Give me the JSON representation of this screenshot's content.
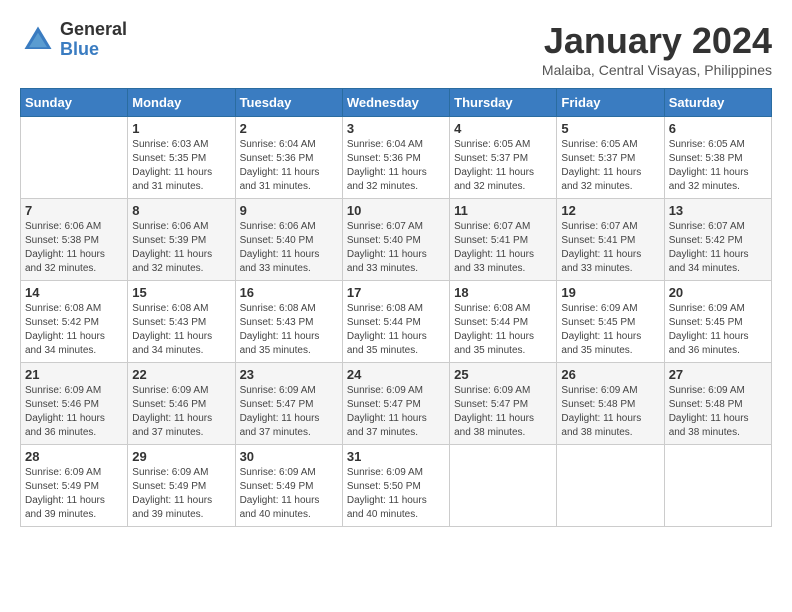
{
  "header": {
    "logo_general": "General",
    "logo_blue": "Blue",
    "title": "January 2024",
    "location": "Malaiba, Central Visayas, Philippines"
  },
  "days_of_week": [
    "Sunday",
    "Monday",
    "Tuesday",
    "Wednesday",
    "Thursday",
    "Friday",
    "Saturday"
  ],
  "weeks": [
    [
      {
        "day": "",
        "sunrise": "",
        "sunset": "",
        "daylight": ""
      },
      {
        "day": "1",
        "sunrise": "6:03 AM",
        "sunset": "5:35 PM",
        "hours": "11",
        "minutes": "31"
      },
      {
        "day": "2",
        "sunrise": "6:04 AM",
        "sunset": "5:36 PM",
        "hours": "11",
        "minutes": "31"
      },
      {
        "day": "3",
        "sunrise": "6:04 AM",
        "sunset": "5:36 PM",
        "hours": "11",
        "minutes": "32"
      },
      {
        "day": "4",
        "sunrise": "6:05 AM",
        "sunset": "5:37 PM",
        "hours": "11",
        "minutes": "32"
      },
      {
        "day": "5",
        "sunrise": "6:05 AM",
        "sunset": "5:37 PM",
        "hours": "11",
        "minutes": "32"
      },
      {
        "day": "6",
        "sunrise": "6:05 AM",
        "sunset": "5:38 PM",
        "hours": "11",
        "minutes": "32"
      }
    ],
    [
      {
        "day": "7",
        "sunrise": "6:06 AM",
        "sunset": "5:38 PM",
        "hours": "11",
        "minutes": "32"
      },
      {
        "day": "8",
        "sunrise": "6:06 AM",
        "sunset": "5:39 PM",
        "hours": "11",
        "minutes": "32"
      },
      {
        "day": "9",
        "sunrise": "6:06 AM",
        "sunset": "5:40 PM",
        "hours": "11",
        "minutes": "33"
      },
      {
        "day": "10",
        "sunrise": "6:07 AM",
        "sunset": "5:40 PM",
        "hours": "11",
        "minutes": "33"
      },
      {
        "day": "11",
        "sunrise": "6:07 AM",
        "sunset": "5:41 PM",
        "hours": "11",
        "minutes": "33"
      },
      {
        "day": "12",
        "sunrise": "6:07 AM",
        "sunset": "5:41 PM",
        "hours": "11",
        "minutes": "33"
      },
      {
        "day": "13",
        "sunrise": "6:07 AM",
        "sunset": "5:42 PM",
        "hours": "11",
        "minutes": "34"
      }
    ],
    [
      {
        "day": "14",
        "sunrise": "6:08 AM",
        "sunset": "5:42 PM",
        "hours": "11",
        "minutes": "34"
      },
      {
        "day": "15",
        "sunrise": "6:08 AM",
        "sunset": "5:43 PM",
        "hours": "11",
        "minutes": "34"
      },
      {
        "day": "16",
        "sunrise": "6:08 AM",
        "sunset": "5:43 PM",
        "hours": "11",
        "minutes": "35"
      },
      {
        "day": "17",
        "sunrise": "6:08 AM",
        "sunset": "5:44 PM",
        "hours": "11",
        "minutes": "35"
      },
      {
        "day": "18",
        "sunrise": "6:08 AM",
        "sunset": "5:44 PM",
        "hours": "11",
        "minutes": "35"
      },
      {
        "day": "19",
        "sunrise": "6:09 AM",
        "sunset": "5:45 PM",
        "hours": "11",
        "minutes": "35"
      },
      {
        "day": "20",
        "sunrise": "6:09 AM",
        "sunset": "5:45 PM",
        "hours": "11",
        "minutes": "36"
      }
    ],
    [
      {
        "day": "21",
        "sunrise": "6:09 AM",
        "sunset": "5:46 PM",
        "hours": "11",
        "minutes": "36"
      },
      {
        "day": "22",
        "sunrise": "6:09 AM",
        "sunset": "5:46 PM",
        "hours": "11",
        "minutes": "37"
      },
      {
        "day": "23",
        "sunrise": "6:09 AM",
        "sunset": "5:47 PM",
        "hours": "11",
        "minutes": "37"
      },
      {
        "day": "24",
        "sunrise": "6:09 AM",
        "sunset": "5:47 PM",
        "hours": "11",
        "minutes": "37"
      },
      {
        "day": "25",
        "sunrise": "6:09 AM",
        "sunset": "5:47 PM",
        "hours": "11",
        "minutes": "38"
      },
      {
        "day": "26",
        "sunrise": "6:09 AM",
        "sunset": "5:48 PM",
        "hours": "11",
        "minutes": "38"
      },
      {
        "day": "27",
        "sunrise": "6:09 AM",
        "sunset": "5:48 PM",
        "hours": "11",
        "minutes": "38"
      }
    ],
    [
      {
        "day": "28",
        "sunrise": "6:09 AM",
        "sunset": "5:49 PM",
        "hours": "11",
        "minutes": "39"
      },
      {
        "day": "29",
        "sunrise": "6:09 AM",
        "sunset": "5:49 PM",
        "hours": "11",
        "minutes": "39"
      },
      {
        "day": "30",
        "sunrise": "6:09 AM",
        "sunset": "5:49 PM",
        "hours": "11",
        "minutes": "40"
      },
      {
        "day": "31",
        "sunrise": "6:09 AM",
        "sunset": "5:50 PM",
        "hours": "11",
        "minutes": "40"
      },
      {
        "day": "",
        "sunrise": "",
        "sunset": "",
        "hours": "",
        "minutes": ""
      },
      {
        "day": "",
        "sunrise": "",
        "sunset": "",
        "hours": "",
        "minutes": ""
      },
      {
        "day": "",
        "sunrise": "",
        "sunset": "",
        "hours": "",
        "minutes": ""
      }
    ]
  ]
}
